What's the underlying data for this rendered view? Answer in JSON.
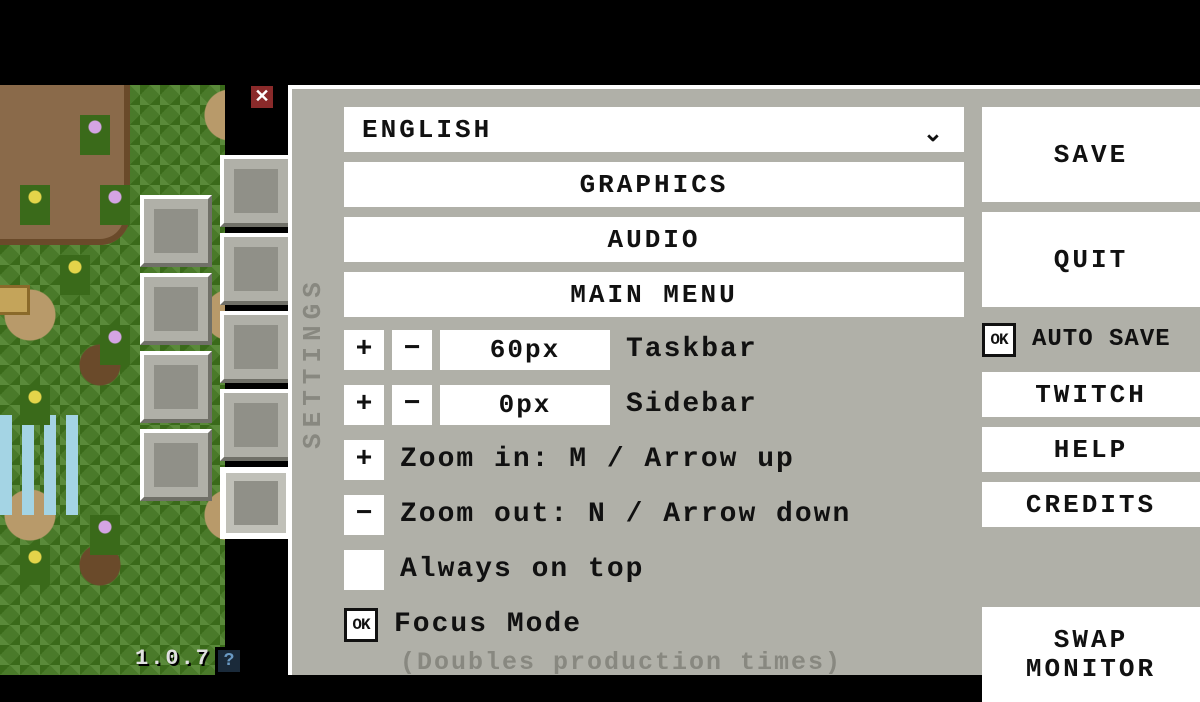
{
  "version": "1.0.7",
  "panel_title": "SETTINGS",
  "language": {
    "selected": "ENGLISH"
  },
  "main_buttons": {
    "graphics": "GRAPHICS",
    "audio": "AUDIO",
    "main_menu": "MAIN MENU"
  },
  "taskbar": {
    "value": "60px",
    "label": "Taskbar",
    "plus": "+",
    "minus": "−"
  },
  "sidebar_size": {
    "value": "0px",
    "label": "Sidebar",
    "plus": "+",
    "minus": "−"
  },
  "zoom_in": {
    "sign": "+",
    "label": "Zoom in: M / Arrow up"
  },
  "zoom_out": {
    "sign": "−",
    "label": "Zoom out: N / Arrow down"
  },
  "always_on_top": {
    "checked": false,
    "label": "Always on top"
  },
  "focus_mode": {
    "checked": true,
    "mark": "OK",
    "label": "Focus Mode",
    "sub": "(Doubles production times)"
  },
  "side_buttons": {
    "save": "SAVE",
    "quit": "QUIT",
    "auto_save": {
      "checked": true,
      "mark": "OK",
      "label": "AUTO SAVE"
    },
    "twitch": "TWITCH",
    "help": "HELP",
    "credits": "CREDITS",
    "swap_monitor_l1": "SWAP",
    "swap_monitor_l2": "MONITOR"
  },
  "icons": {
    "close": "✕",
    "help_corner": "?",
    "chevron_down": "⌄"
  }
}
